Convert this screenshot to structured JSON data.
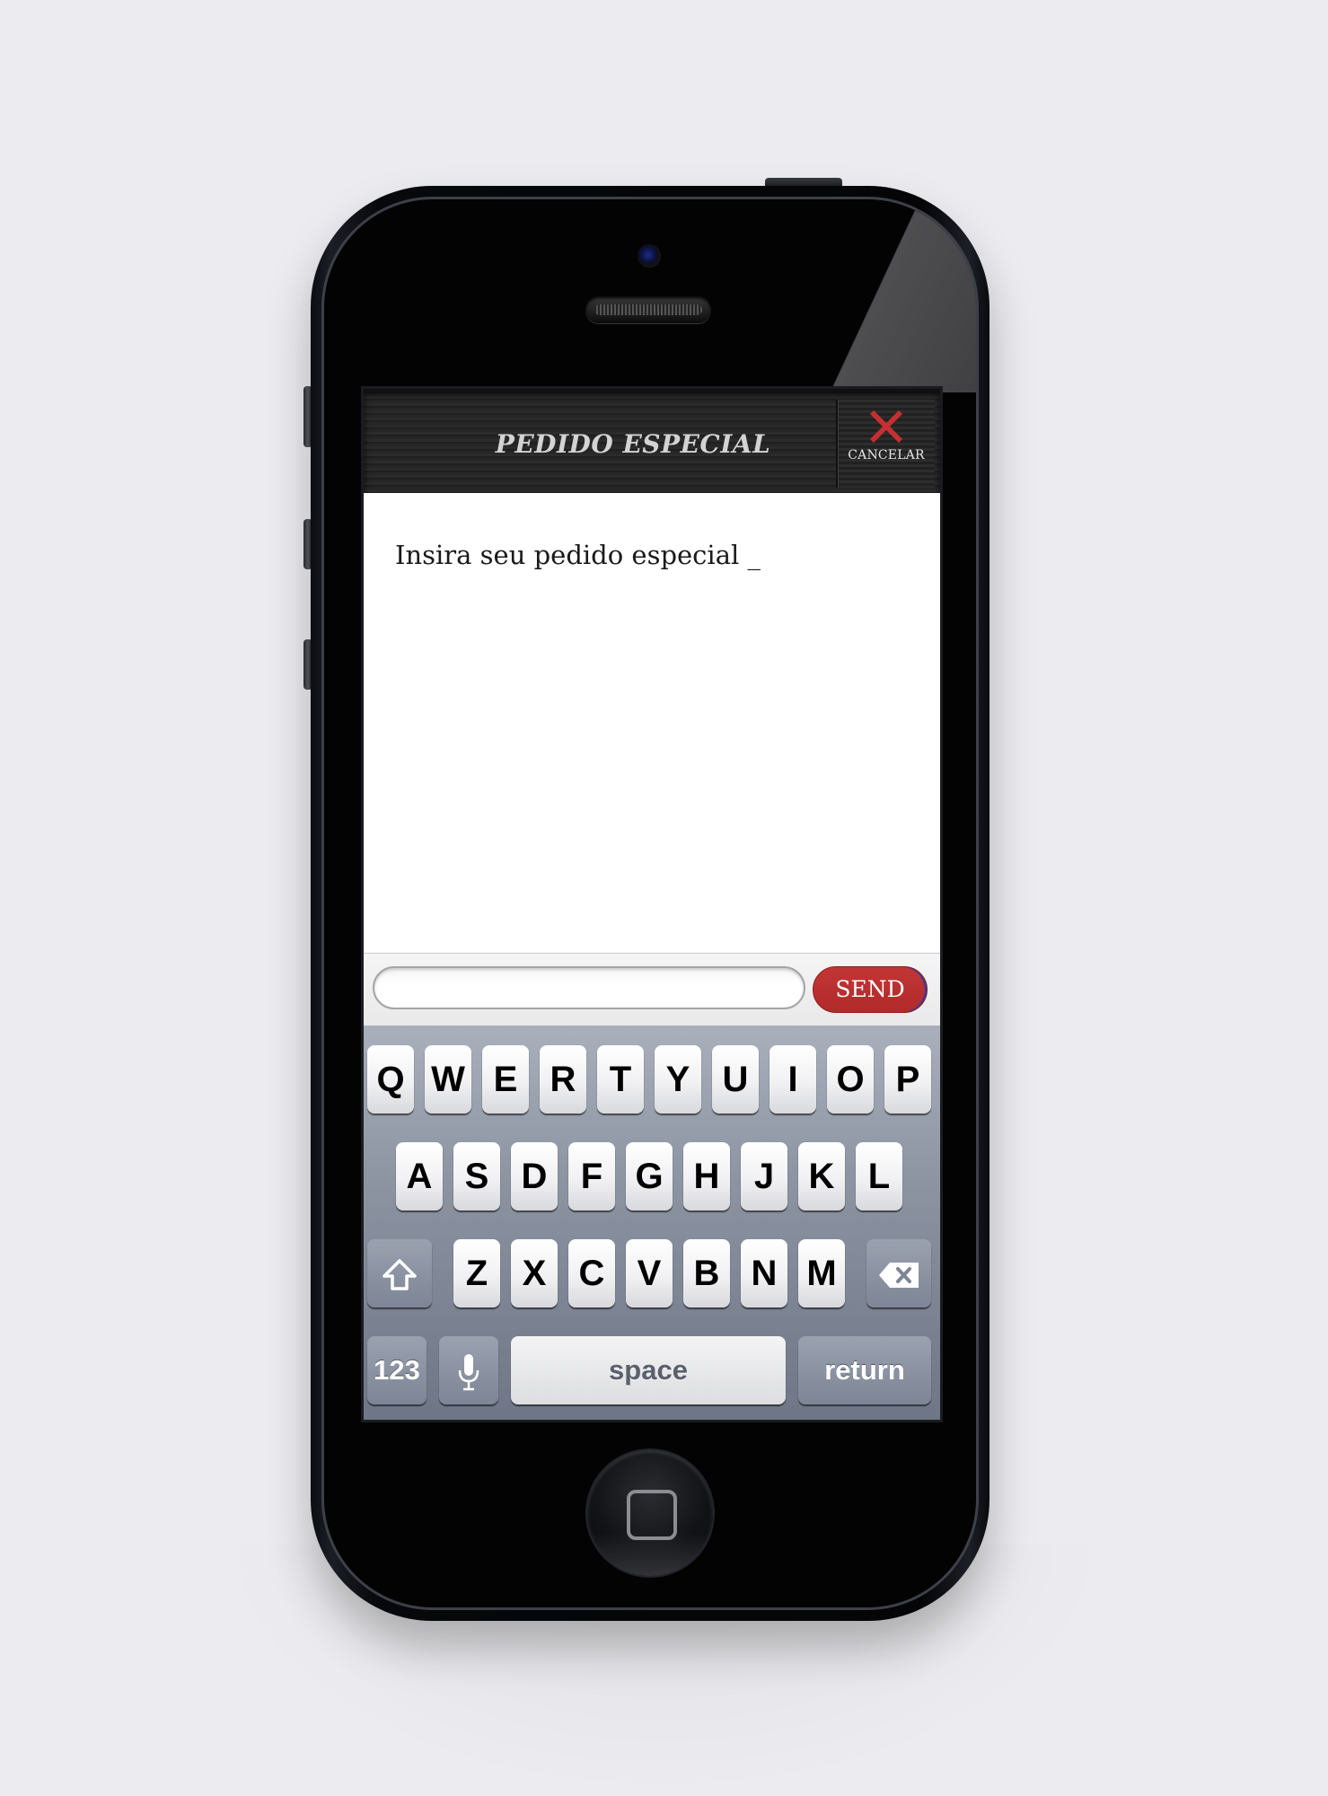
{
  "header": {
    "title": "PEDIDO ESPECIAL",
    "cancel_label": "CANCELAR"
  },
  "content": {
    "prompt": "Insira seu pedido especial _"
  },
  "composer": {
    "input_value": "",
    "send_label": "SEND"
  },
  "keyboard": {
    "row1": [
      "Q",
      "W",
      "E",
      "R",
      "T",
      "Y",
      "U",
      "I",
      "O",
      "P"
    ],
    "row2": [
      "A",
      "S",
      "D",
      "F",
      "G",
      "H",
      "J",
      "K",
      "L"
    ],
    "row3": [
      "Z",
      "X",
      "C",
      "V",
      "B",
      "N",
      "M"
    ],
    "numbers_label": "123",
    "space_label": "space",
    "return_label": "return"
  },
  "colors": {
    "accent": "#b82e2e",
    "nav_bg": "#262626",
    "keyboard_bg": "#8c94a2"
  },
  "icons": [
    "close-icon",
    "shift-icon",
    "backspace-icon",
    "microphone-icon",
    "home-button-icon"
  ]
}
